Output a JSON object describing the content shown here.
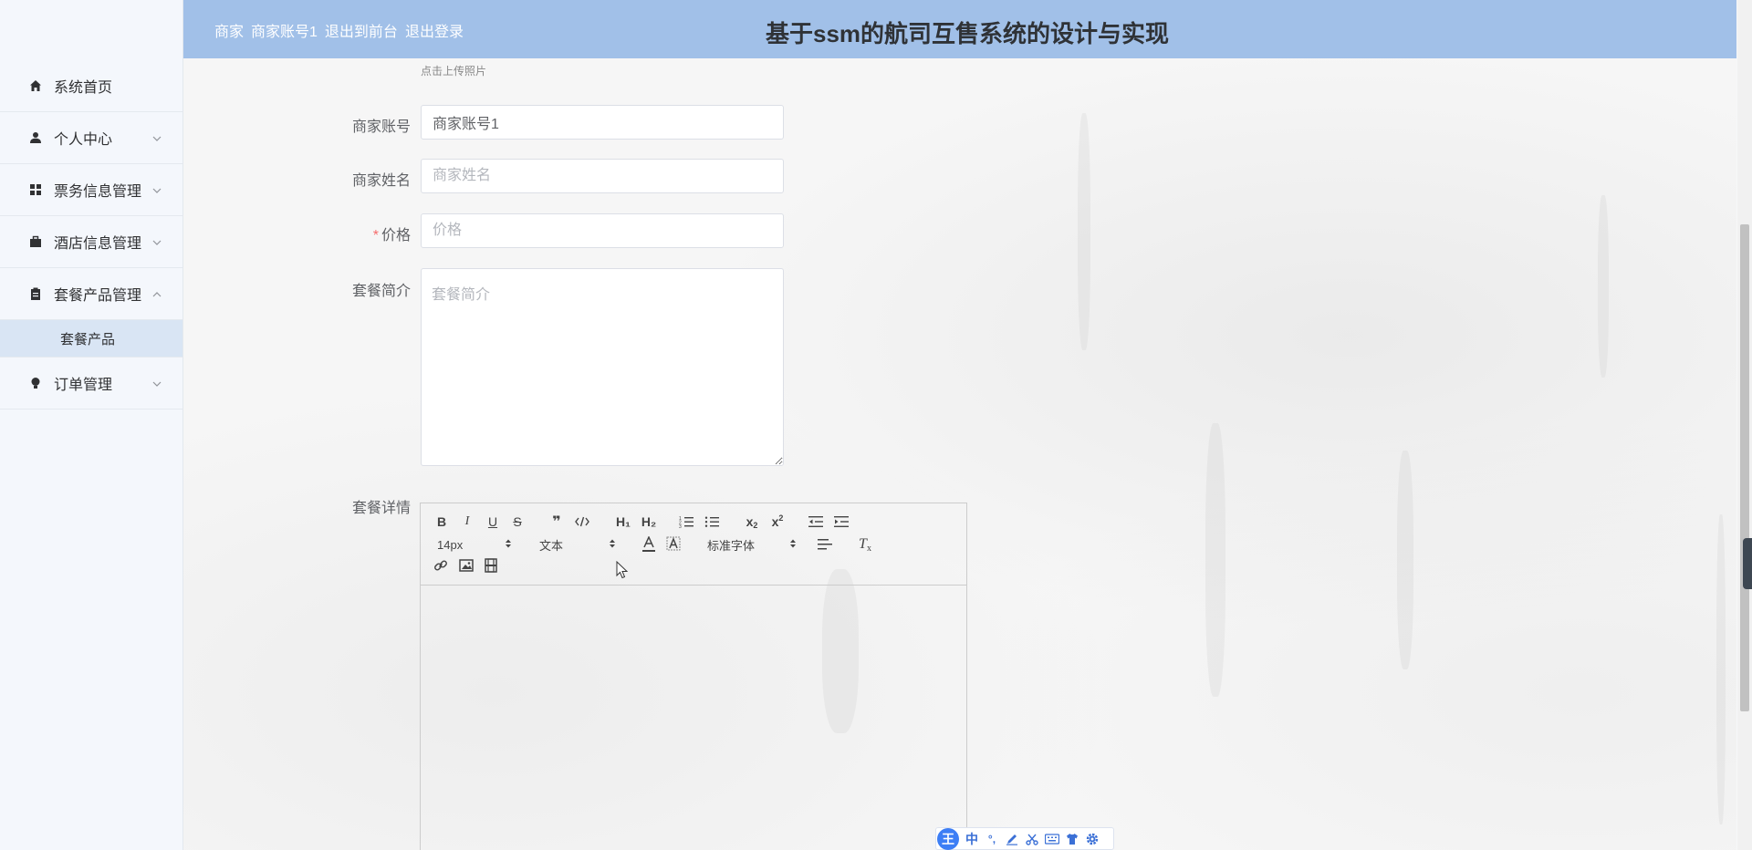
{
  "header": {
    "role": "商家",
    "account": "商家账号1",
    "back_link": "退出到前台",
    "logout_link": "退出登录",
    "title": "基于ssm的航司互售系统的设计与实现"
  },
  "sidebar": {
    "items": [
      {
        "label": "系统首页",
        "icon": "home-icon",
        "has_chevron": false
      },
      {
        "label": "个人中心",
        "icon": "user-icon",
        "has_chevron": true,
        "expanded": false
      },
      {
        "label": "票务信息管理",
        "icon": "grid-icon",
        "has_chevron": true,
        "expanded": false
      },
      {
        "label": "酒店信息管理",
        "icon": "briefcase-icon",
        "has_chevron": true,
        "expanded": false
      },
      {
        "label": "套餐产品管理",
        "icon": "clipboard-icon",
        "has_chevron": true,
        "expanded": true,
        "children": [
          {
            "label": "套餐产品",
            "active": true
          }
        ]
      },
      {
        "label": "订单管理",
        "icon": "bulb-icon",
        "has_chevron": true,
        "expanded": false
      }
    ]
  },
  "form": {
    "upload_hint": "点击上传照片",
    "merchant_account": {
      "label": "商家账号",
      "value": "商家账号1"
    },
    "merchant_name": {
      "label": "商家姓名",
      "placeholder": "商家姓名"
    },
    "price": {
      "label": "价格",
      "placeholder": "价格",
      "required_mark": "*"
    },
    "package_intro": {
      "label": "套餐简介",
      "placeholder": "套餐简介"
    },
    "package_detail": {
      "label": "套餐详情"
    }
  },
  "editor": {
    "size_picker": "14px",
    "header_picker": "文本",
    "font_picker": "标准字体",
    "buttons": [
      "bold",
      "italic",
      "underline",
      "strike",
      "blockquote",
      "code-block",
      "h1",
      "h2",
      "ordered-list",
      "bullet-list",
      "subscript",
      "superscript",
      "outdent",
      "indent",
      "color",
      "background",
      "align",
      "clean",
      "link",
      "image",
      "video"
    ],
    "labels": {
      "h1": "H₁",
      "h2": "H₂"
    }
  },
  "ime": {
    "logo": "王",
    "mode": "中",
    "punct": "°,",
    "icons": [
      "pen-icon",
      "scissors-icon",
      "keyboard-icon",
      "shirt-icon",
      "settings-icon"
    ]
  },
  "colors": {
    "header_bg": "#a1c0e8",
    "sidebar_bg": "#f4f7fc",
    "submenu_active_bg": "#d9e5f4",
    "required": "#f56c6c"
  }
}
